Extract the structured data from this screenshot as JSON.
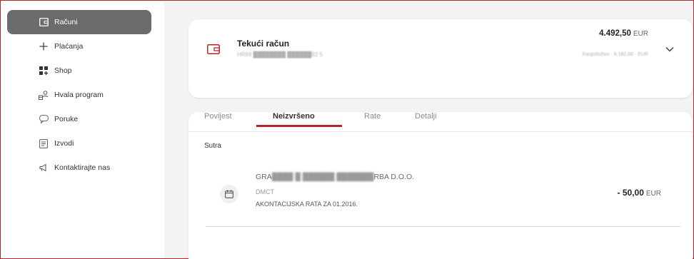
{
  "sidebar": {
    "items": [
      {
        "label": "Računi",
        "icon": "accounts-icon",
        "active": true
      },
      {
        "label": "Plaćanja",
        "icon": "plus-icon",
        "active": false
      },
      {
        "label": "Shop",
        "icon": "shop-grid-icon",
        "active": false
      },
      {
        "label": "Hvala program",
        "icon": "loyalty-program-icon",
        "active": false
      },
      {
        "label": "Poruke",
        "icon": "message-bubble-icon",
        "active": false
      },
      {
        "label": "Izvodi",
        "icon": "statement-doc-icon",
        "active": false
      },
      {
        "label": "Kontaktirajte nas",
        "icon": "megaphone-icon",
        "active": false
      }
    ]
  },
  "account": {
    "name": "Tekući račun",
    "iban_masked": "HR69 ████████ ██████92 5",
    "balance": "4.492,50",
    "currency": "EUR",
    "available_masked": "Raspoloživo · 6.182,00 · EUR"
  },
  "tabs": [
    {
      "label": "Povijest",
      "active": false
    },
    {
      "label": "Neizvršeno",
      "active": true
    },
    {
      "label": "Rate",
      "active": false
    },
    {
      "label": "Detalji",
      "active": false
    }
  ],
  "section_title": "Sutra",
  "transaction": {
    "payee_prefix": "GRA",
    "payee_masked": "████ █ ██████ ███████",
    "payee_suffix": "RBA D.O.O.",
    "type": "DMCT",
    "description": "AKONTACIJSKA RATA ZA 01.2016.",
    "amount": "- 50,00",
    "currency": "EUR"
  },
  "colors": {
    "accent": "#b3262c",
    "sidebar_active_bg": "#6b6b6b",
    "content_bg": "#f3f3f3"
  }
}
